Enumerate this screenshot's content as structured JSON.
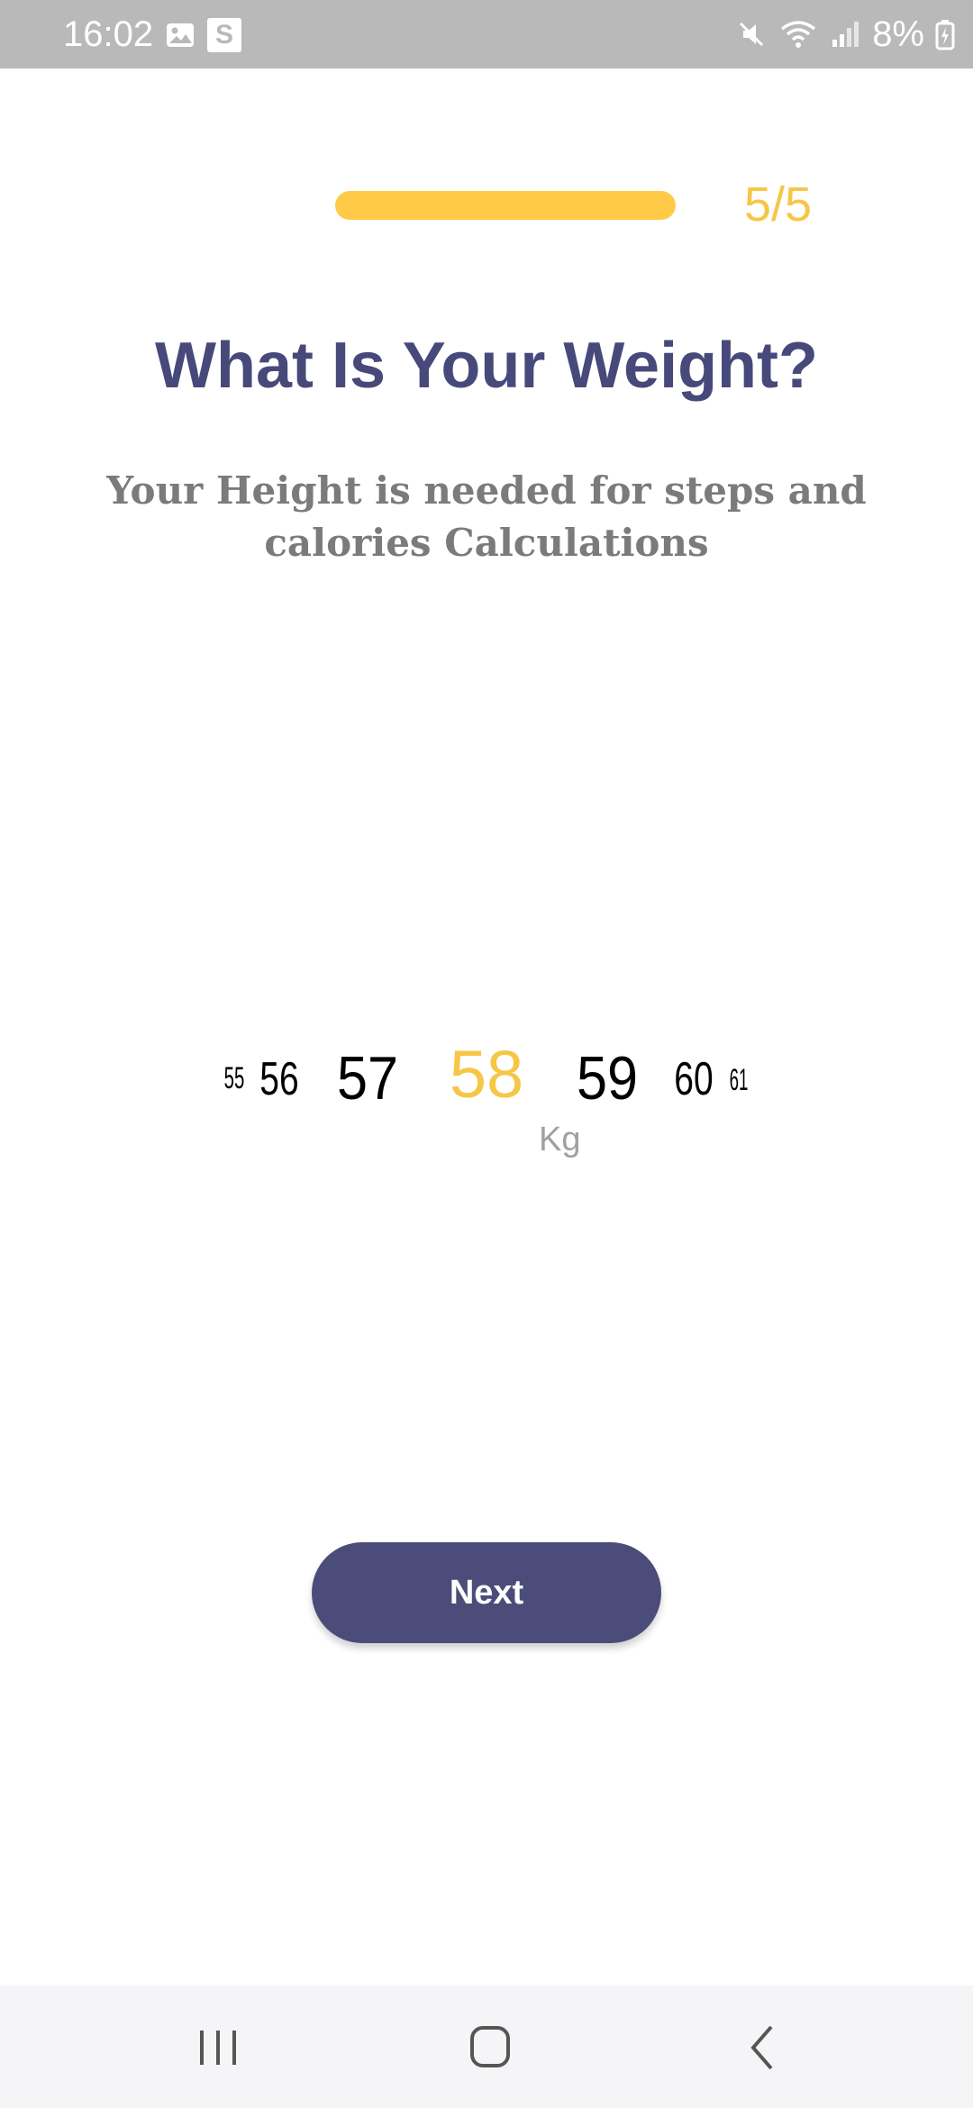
{
  "status_bar": {
    "time": "16:02",
    "s_badge": "S",
    "battery": "8%",
    "icons": [
      "gallery-icon",
      "s-app-icon",
      "mute-icon",
      "wifi-icon",
      "signal-icon",
      "battery-icon"
    ]
  },
  "progress": {
    "label": "5/5",
    "value": 1.0,
    "fill_color": "#ffcb47"
  },
  "title": "What Is Your Weight?",
  "subtitle": "Your Height is needed for steps and calories Calculations",
  "picker": {
    "values": [
      "55",
      "56",
      "57",
      "58",
      "59",
      "60",
      "61"
    ],
    "selected": "58",
    "unit": "Kg",
    "selected_color": "#f6c646"
  },
  "next_button": {
    "label": "Next",
    "color": "#4b4c7a"
  },
  "nav_bar": {
    "icons": [
      "recents-icon",
      "home-icon",
      "back-icon"
    ]
  },
  "colors": {
    "accent": "#ffcb47",
    "title": "#47497a",
    "subtitle": "#7b7b7b",
    "status_bar": "#b9b9b9"
  }
}
